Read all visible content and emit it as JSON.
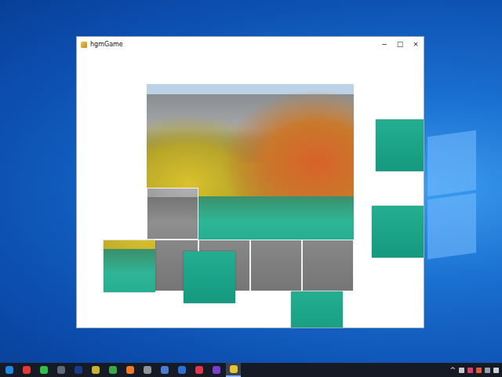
{
  "window": {
    "title": "hgmGame",
    "controls": [
      "−",
      "□",
      "×"
    ]
  },
  "board": {
    "cells": [
      {
        "placed": true
      },
      {
        "placed": true
      },
      {
        "placed": true
      },
      {
        "placed": true
      },
      {
        "placed": true
      },
      {
        "placed": true
      },
      {
        "placed": true
      },
      {
        "placed": true
      },
      {
        "placed": false
      },
      {
        "placed": true
      },
      {
        "placed": true
      },
      {
        "placed": true
      },
      {
        "placed": false
      },
      {
        "placed": false
      },
      {
        "placed": false
      },
      {
        "placed": false
      }
    ]
  },
  "taskbar": {
    "apps": [
      {
        "color": "#1e88e5",
        "active": false
      },
      {
        "color": "#e53935",
        "active": false
      },
      {
        "color": "#2fbf4a",
        "active": false
      },
      {
        "color": "#5f6b78",
        "active": false
      },
      {
        "color": "#1a3a8a",
        "active": false
      },
      {
        "color": "#c7b32c",
        "active": false
      },
      {
        "color": "#3aa84a",
        "active": false
      },
      {
        "color": "#f0792b",
        "active": false
      },
      {
        "color": "#8d949c",
        "active": false
      },
      {
        "color": "#4a7bd6",
        "active": false
      },
      {
        "color": "#2b6fd6",
        "active": false
      },
      {
        "color": "#e0364e",
        "active": false
      },
      {
        "color": "#7a3fd0",
        "active": false
      },
      {
        "color": "#e8c330",
        "active": true
      }
    ],
    "tray": {
      "chevron": "^",
      "icons": [
        {
          "color": "#c8c8c8"
        },
        {
          "color": "#d8406a"
        },
        {
          "color": "#e05a3a"
        },
        {
          "color": "#9aa0a8"
        },
        {
          "color": "#d0d0d0"
        }
      ]
    }
  }
}
